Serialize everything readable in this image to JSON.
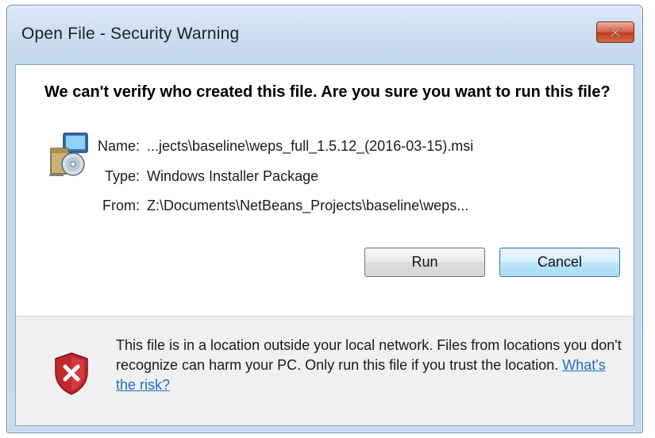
{
  "window": {
    "title": "Open File - Security Warning"
  },
  "headline": "We can't verify who created this file. Are you sure you want to run this file?",
  "file": {
    "name_label": "Name:",
    "name_value": "...jects\\baseline\\weps_full_1.5.12_(2016-03-15).msi",
    "type_label": "Type:",
    "type_value": "Windows Installer Package",
    "from_label": "From:",
    "from_value": "Z:\\Documents\\NetBeans_Projects\\baseline\\weps..."
  },
  "buttons": {
    "run": "Run",
    "cancel": "Cancel"
  },
  "warning": {
    "text": "This file is in a location outside your local network. Files from locations you don't recognize can harm your PC. Only run this file if you trust the location.",
    "link": "What's the risk?"
  },
  "icons": {
    "close": "close-icon",
    "installer": "installer-package-icon",
    "shield": "shield-error-icon"
  },
  "colors": {
    "close_button": "#c7462a",
    "link": "#1c6ec1",
    "shield": "#c1272d"
  }
}
